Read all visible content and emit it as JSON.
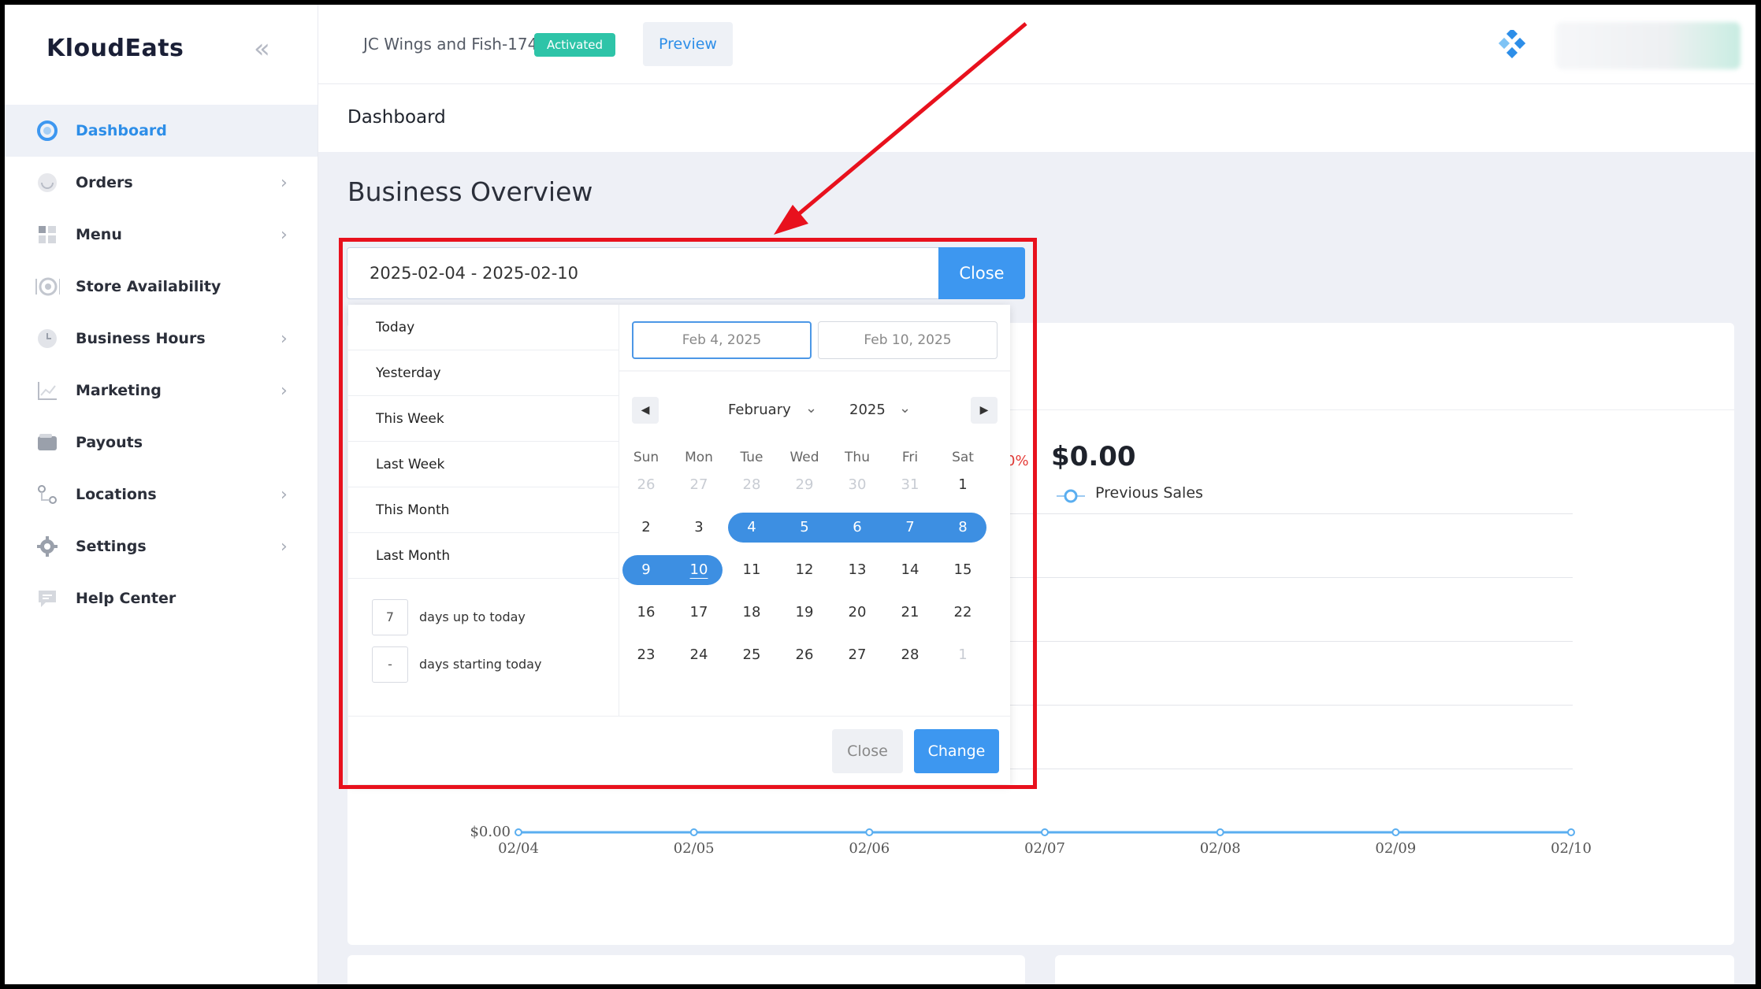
{
  "sidebar": {
    "brand": "KloudEats",
    "items": [
      {
        "label": "Dashboard",
        "icon": "dashboard-icon",
        "active": true,
        "has_submenu": false
      },
      {
        "label": "Orders",
        "icon": "orders-icon",
        "active": false,
        "has_submenu": true
      },
      {
        "label": "Menu",
        "icon": "menu-grid-icon",
        "active": false,
        "has_submenu": true
      },
      {
        "label": "Store Availability",
        "icon": "store-availability-icon",
        "active": false,
        "has_submenu": false
      },
      {
        "label": "Business Hours",
        "icon": "clock-icon",
        "active": false,
        "has_submenu": true
      },
      {
        "label": "Marketing",
        "icon": "chart-line-icon",
        "active": false,
        "has_submenu": true
      },
      {
        "label": "Payouts",
        "icon": "wallet-icon",
        "active": false,
        "has_submenu": false
      },
      {
        "label": "Locations",
        "icon": "locations-icon",
        "active": false,
        "has_submenu": true
      },
      {
        "label": "Settings",
        "icon": "gear-icon",
        "active": false,
        "has_submenu": true
      },
      {
        "label": "Help Center",
        "icon": "chat-icon",
        "active": false,
        "has_submenu": false
      }
    ]
  },
  "topbar": {
    "store_name": "JC Wings and Fish-174",
    "status": "Activated",
    "preview_label": "Preview"
  },
  "page": {
    "title": "Dashboard",
    "section_title": "Business Overview"
  },
  "overview": {
    "change_fragment": "0%",
    "previous_value": "$0.00",
    "previous_label": "Previous Sales"
  },
  "chart_data": {
    "type": "line",
    "x": [
      "02/04",
      "02/05",
      "02/06",
      "02/07",
      "02/08",
      "02/09",
      "02/10"
    ],
    "series": [
      {
        "name": "Previous Sales",
        "values": [
          0,
          0,
          0,
          0,
          0,
          0,
          0
        ]
      }
    ],
    "ytick_labels": [
      "$0.00"
    ],
    "grid": true
  },
  "date_picker": {
    "range_text": "2025-02-04 - 2025-02-10",
    "close_label": "Close",
    "presets": [
      "Today",
      "Yesterday",
      "This Week",
      "Last Week",
      "This Month",
      "Last Month"
    ],
    "days_up_to_today": {
      "value": "7",
      "label": "days up to today"
    },
    "days_starting_today": {
      "value": "-",
      "label": "days starting today"
    },
    "start_date": "Feb 4, 2025",
    "end_date": "Feb 10, 2025",
    "month": "February",
    "year": "2025",
    "weekdays": [
      "Sun",
      "Mon",
      "Tue",
      "Wed",
      "Thu",
      "Fri",
      "Sat"
    ],
    "weeks": [
      [
        "26",
        "27",
        "28",
        "29",
        "30",
        "31",
        "1"
      ],
      [
        "2",
        "3",
        "4",
        "5",
        "6",
        "7",
        "8"
      ],
      [
        "9",
        "10",
        "11",
        "12",
        "13",
        "14",
        "15"
      ],
      [
        "16",
        "17",
        "18",
        "19",
        "20",
        "21",
        "22"
      ],
      [
        "23",
        "24",
        "25",
        "26",
        "27",
        "28",
        "1"
      ]
    ],
    "selected_start": "4",
    "selected_end": "10",
    "footer_close_label": "Close",
    "footer_change_label": "Change"
  },
  "colors": {
    "accent": "#3d97f0",
    "range": "#3d8fe2",
    "status_badge": "#2ec4a8",
    "annotation": "#e8111d",
    "negative": "#e53935"
  }
}
